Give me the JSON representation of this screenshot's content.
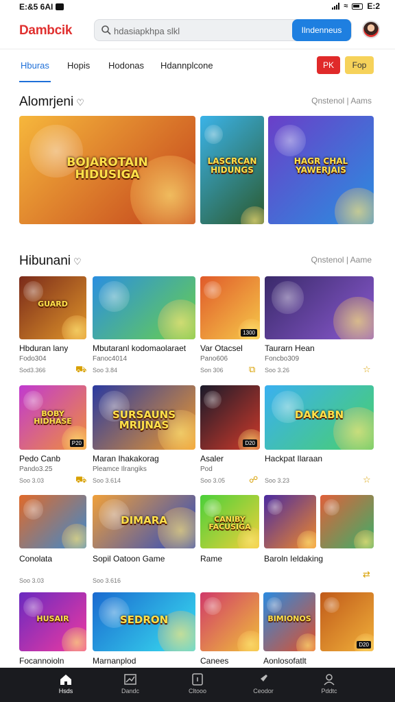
{
  "status": {
    "time": "E:&5 6AI",
    "right": "E:2"
  },
  "header": {
    "logo": "Dambcik",
    "search_placeholder": "hdasiapkhpa slkl",
    "search_button": "Ilndenneus"
  },
  "tabs": [
    {
      "label": "Hburas"
    },
    {
      "label": "Hopis"
    },
    {
      "label": "Hodonas"
    },
    {
      "label": "Hdannplcone"
    }
  ],
  "pills": {
    "red": "PK",
    "yellow": "Fop"
  },
  "sections": {
    "featured": {
      "title": "Alomrjeni",
      "more": "Qnstenol | Aams"
    },
    "games": {
      "title": "Hibunani",
      "more": "Qnstenol | Aame"
    }
  },
  "featured": [
    {
      "art_text": "BOJAROTAIN HIDUSIGA",
      "colors": [
        "#f6b73c",
        "#c2411b"
      ]
    },
    {
      "art_text": "LASCRCAN HIDUNGS",
      "colors": [
        "#3bb3e8",
        "#2b5a2f"
      ]
    },
    {
      "art_text": "HAGR CHAL YAWERJAIS",
      "colors": [
        "#6a3fc8",
        "#2a8fe0"
      ]
    }
  ],
  "games": [
    {
      "title": "Hbduran lany",
      "sub": "Fodo304",
      "meta": "Sod3.366",
      "art_text": "GUARD",
      "tag": "",
      "colors": [
        "#7a2a1a",
        "#e0962a"
      ],
      "icon": "cart-icon"
    },
    {
      "title": "Mbutaranl kodomaolaraet",
      "sub": "Fanoc4014",
      "meta": "Soo 3.84",
      "art_text": "",
      "tag": "",
      "colors": [
        "#2b8fe0",
        "#6ad04a"
      ],
      "icon": ""
    },
    {
      "title": "Var Otacsel",
      "sub": "Pano606",
      "meta": "Son 306",
      "art_text": "",
      "tag": "1300",
      "colors": [
        "#e05a2a",
        "#f6c94a"
      ],
      "icon": "copy-icon"
    },
    {
      "title": "Taurarn Hean",
      "sub": "Foncbo309",
      "meta": "Soo 3.26",
      "art_text": "",
      "tag": "",
      "colors": [
        "#3a2a6a",
        "#8a5ad0"
      ],
      "icon": "star-icon"
    },
    {
      "title": "Pedo Canb",
      "sub": "Pando3.25",
      "meta": "Soo 3.03",
      "art_text": "BOBY HIDHASE",
      "tag": "P20",
      "colors": [
        "#c03ad0",
        "#f0903a"
      ],
      "icon": "cart-icon"
    },
    {
      "title": "Maran Ihakakorag",
      "sub": "Pleamce Ilrangiks",
      "meta": "Soo 3.614",
      "art_text": "SURSAUNS MRIJNAS",
      "tag": "",
      "colors": [
        "#2a3aa0",
        "#f09a2a"
      ],
      "icon": ""
    },
    {
      "title": "Asaler",
      "sub": "Pod",
      "meta": "Soo 3.05",
      "art_text": "",
      "tag": "D20",
      "colors": [
        "#1a1a2a",
        "#d03a2a"
      ],
      "icon": "link-icon"
    },
    {
      "title": "Hackpat Ilaraan",
      "sub": "",
      "meta": "Soo 3.23",
      "art_text": "DAKABN",
      "tag": "",
      "colors": [
        "#3ab0f0",
        "#4ad06a"
      ],
      "icon": "star-icon"
    },
    {
      "title": "Conolata",
      "sub": "",
      "meta": "Soo 3.03",
      "art_text": "",
      "tag": "",
      "colors": [
        "#e06a2a",
        "#3a8ad0"
      ],
      "icon": ""
    },
    {
      "title": "Sopil Oatoon Game",
      "sub": "",
      "meta": "Soo 3.616",
      "art_text": "DIMARA",
      "tag": "",
      "colors": [
        "#f0a03a",
        "#2a4ac0"
      ],
      "icon": ""
    },
    {
      "title": "Rame",
      "sub": "",
      "meta": "",
      "art_text": "CANIBY FACUSIGA",
      "tag": "",
      "colors": [
        "#4ad03a",
        "#f0d03a"
      ],
      "icon": ""
    },
    {
      "title": "Baroln Ieldaking",
      "sub": "",
      "meta": "",
      "art_text": "",
      "tag": "",
      "colors": [
        "#4a2aa0",
        "#f08a2a"
      ],
      "icon": ""
    },
    {
      "title": "",
      "sub": "",
      "meta": "",
      "art_text": "",
      "tag": "",
      "colors": [
        "#e0603a",
        "#3ab06a"
      ],
      "icon": "swap-icon"
    },
    {
      "title": "Focannoioln",
      "sub": "",
      "meta": "",
      "art_text": "HUSAIR",
      "tag": "",
      "colors": [
        "#6a2ac0",
        "#f03aa0"
      ],
      "icon": ""
    },
    {
      "title": "Marnanplod",
      "sub": "",
      "meta": "",
      "art_text": "SEDRON",
      "tag": "",
      "colors": [
        "#1a6ad0",
        "#3ae0f0"
      ],
      "icon": ""
    },
    {
      "title": "Canees",
      "sub": "",
      "meta": "",
      "art_text": "",
      "tag": "",
      "colors": [
        "#d03a6a",
        "#f0c03a"
      ],
      "icon": ""
    },
    {
      "title": "Aonlosofatlt",
      "sub": "",
      "meta": "",
      "art_text": "BIMIONOS",
      "tag": "",
      "colors": [
        "#2a8ae0",
        "#e0502a"
      ],
      "icon": ""
    },
    {
      "title": "",
      "sub": "",
      "meta": "",
      "art_text": "",
      "tag": "D20",
      "colors": [
        "#c05a1a",
        "#f0b03a"
      ],
      "icon": ""
    }
  ],
  "bottom_nav": [
    {
      "label": "Hsds",
      "icon": "home-icon"
    },
    {
      "label": "Dandc",
      "icon": "chart-icon"
    },
    {
      "label": "Cltooo",
      "icon": "card-icon"
    },
    {
      "label": "Ceodor",
      "icon": "rocket-icon"
    },
    {
      "label": "Pddtc",
      "icon": "user-icon"
    }
  ]
}
